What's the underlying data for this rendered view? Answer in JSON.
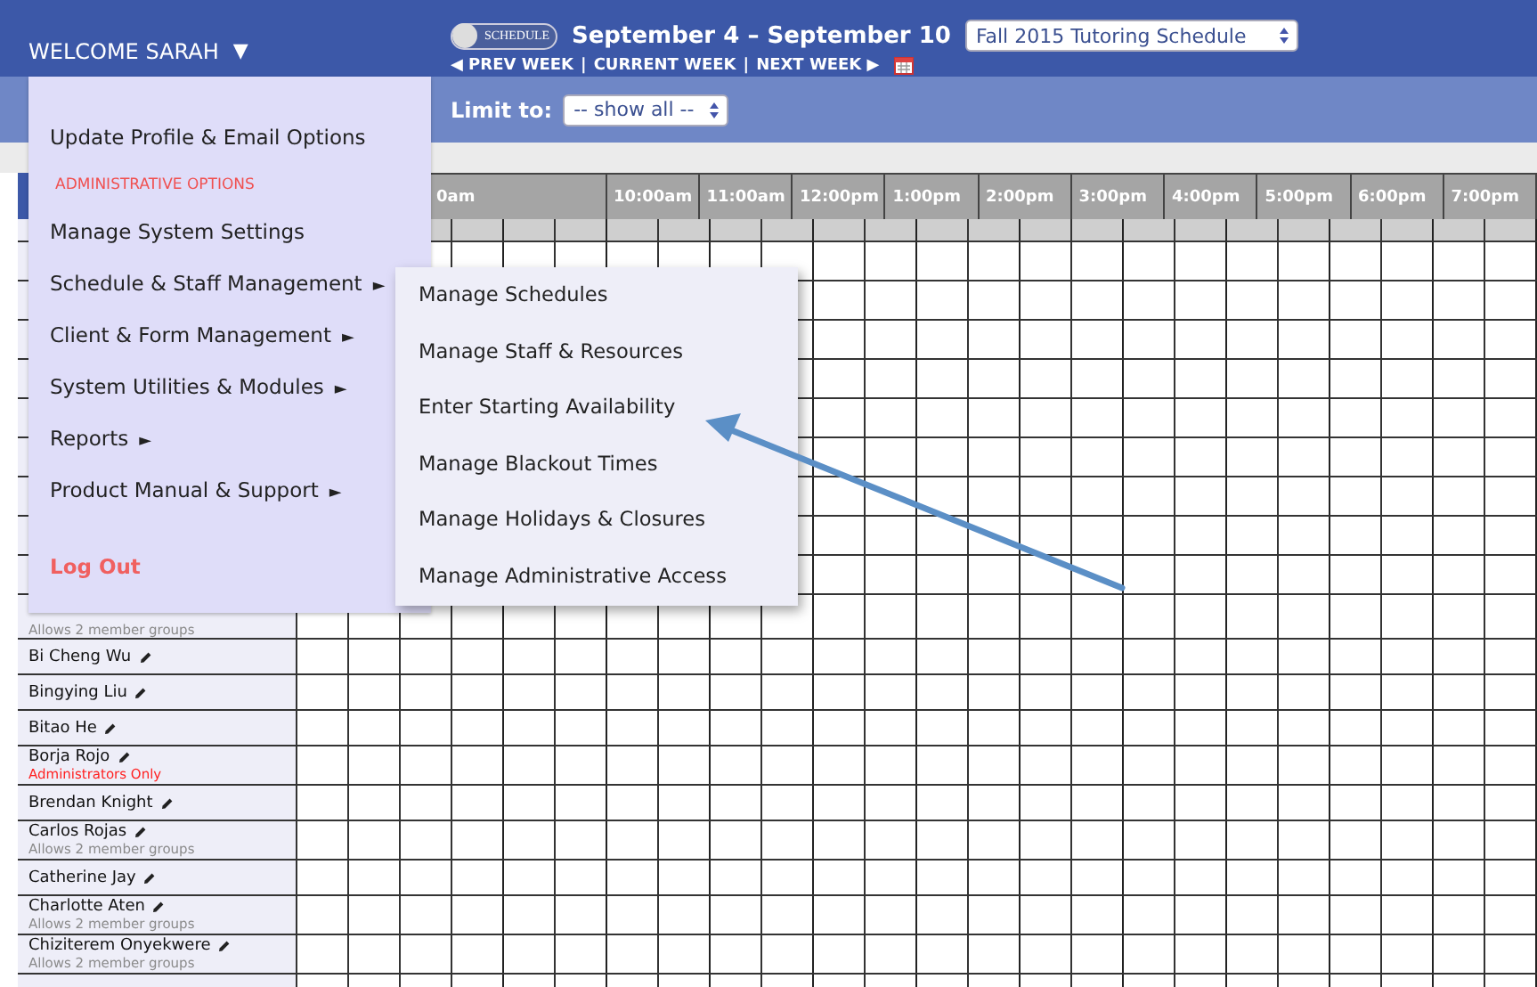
{
  "top_bar": {
    "welcome": "WELCOME SARAH",
    "caret": "▼",
    "toggle": {
      "label": "SCHEDULE",
      "on": false
    },
    "date_range": "September 4 – September 10",
    "schedule_select": "Fall 2015 Tutoring Schedule",
    "week_nav": [
      {
        "label": "◀ PREV WEEK"
      },
      {
        "label": "CURRENT WEEK"
      },
      {
        "label": "NEXT WEEK ▶"
      }
    ],
    "nav_separator": "|"
  },
  "filter_bar": {
    "label": "Limit to:",
    "select": "-- show all --"
  },
  "grid": {
    "hours": [
      {
        "label": "0am"
      },
      {
        "label": "10:00am"
      },
      {
        "label": "11:00am"
      },
      {
        "label": "12:00pm"
      },
      {
        "label": "1:00pm"
      },
      {
        "label": "2:00pm"
      },
      {
        "label": "3:00pm"
      },
      {
        "label": "4:00pm"
      },
      {
        "label": "5:00pm"
      },
      {
        "label": "6:00pm"
      },
      {
        "label": "7:00pm"
      }
    ],
    "rows": [
      {},
      {},
      {},
      {},
      {},
      {},
      {},
      {},
      {},
      {
        "note": {
          "text": "Allows 2 member groups",
          "color": "#8a8a8a"
        }
      },
      {
        "name": "Bi Cheng Wu"
      },
      {
        "name": "Bingying Liu"
      },
      {
        "name": "Bitao He"
      },
      {
        "name": "Borja Rojo",
        "note": {
          "text": "Administrators Only",
          "color": "#ff2020"
        }
      },
      {
        "name": "Brendan Knight"
      },
      {
        "name": "Carlos Rojas",
        "note": {
          "text": "Allows 2 member groups",
          "color": "#8a8a8a"
        }
      },
      {
        "name": "Catherine Jay"
      },
      {
        "name": "Charlotte Aten",
        "note": {
          "text": "Allows 2 member groups",
          "color": "#8a8a8a"
        }
      },
      {
        "name": "Chiziterem Onyekwere",
        "note": {
          "text": "Allows 2 member groups",
          "color": "#8a8a8a"
        }
      },
      {}
    ]
  },
  "menu": {
    "items": [
      {
        "kind": "item",
        "label": "Update Profile & Email Options",
        "submenu": false
      },
      {
        "kind": "heading",
        "label": "ADMINISTRATIVE OPTIONS"
      },
      {
        "kind": "item",
        "label": "Manage System Settings",
        "submenu": false
      },
      {
        "kind": "item",
        "label": "Schedule & Staff Management",
        "submenu": true,
        "expanded": true
      },
      {
        "kind": "item",
        "label": "Client & Form Management",
        "submenu": true,
        "expanded": false
      },
      {
        "kind": "item",
        "label": "System Utilities & Modules",
        "submenu": true,
        "expanded": false
      },
      {
        "kind": "item",
        "label": "Reports",
        "submenu": true,
        "expanded": false
      },
      {
        "kind": "item",
        "label": "Product Manual & Support",
        "submenu": true,
        "expanded": false
      },
      {
        "kind": "logout",
        "label": "Log Out"
      }
    ],
    "submenu_arrow": "►",
    "submenu": [
      "Manage Schedules",
      "Manage Staff & Resources",
      "Enter Starting Availability",
      "Manage Blackout Times",
      "Manage Holidays & Closures",
      "Manage Administrative Access"
    ]
  }
}
